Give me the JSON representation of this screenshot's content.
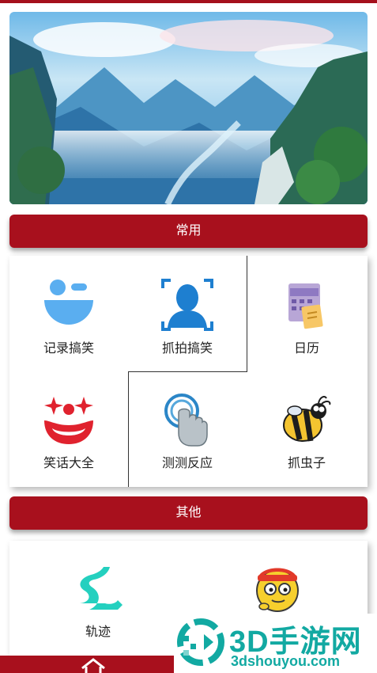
{
  "sections": {
    "common_title": "常用",
    "other_title": "其他"
  },
  "common_items": [
    {
      "label": "记录搞笑",
      "icon": "face-smile-icon"
    },
    {
      "label": "抓拍搞笑",
      "icon": "face-scan-icon"
    },
    {
      "label": "日历",
      "icon": "calendar-icon"
    },
    {
      "label": "笑话大全",
      "icon": "clown-icon"
    },
    {
      "label": "测测反应",
      "icon": "tap-finger-icon"
    },
    {
      "label": "抓虫子",
      "icon": "bee-icon"
    }
  ],
  "other_items": [
    {
      "label": "轨迹",
      "icon": "track-icon"
    },
    {
      "label": "",
      "icon": "emoji-face-icon"
    }
  ],
  "watermark": {
    "title": "3D手游网",
    "url": "3dshouyou.com"
  },
  "colors": {
    "accent": "#a8101d",
    "icon_blue": "#5aaef0",
    "watermark": "#12a9a2"
  }
}
